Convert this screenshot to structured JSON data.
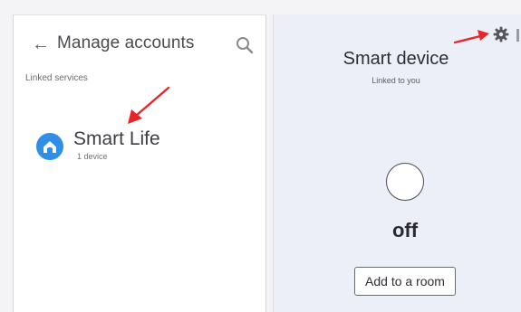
{
  "left_panel": {
    "back_glyph": "←",
    "title": "Manage accounts",
    "section_label": "Linked services",
    "service": {
      "name": "Smart Life",
      "subtitle": "1 device",
      "icon": "smart-life-house-icon"
    },
    "search_icon": "search-icon"
  },
  "right_panel": {
    "title": "Smart device",
    "subtitle": "Linked to you",
    "state": "off",
    "room_button_label": "Add to a room",
    "settings_icon": "gear-icon"
  },
  "colors": {
    "accent_arrow": "#e8262a",
    "smart_life_blue": "#2f8fe6",
    "right_panel_bg": "#eceef8"
  }
}
